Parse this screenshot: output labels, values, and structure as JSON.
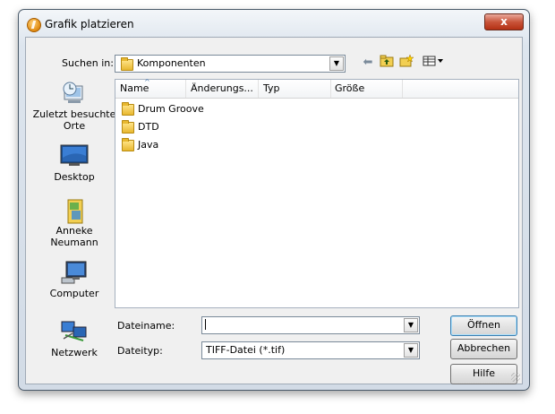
{
  "window": {
    "title": "Grafik platzieren",
    "close_symbol": "x"
  },
  "lookin": {
    "label": "Suchen in:",
    "value": "Komponenten"
  },
  "toolbar": {
    "back_icon": "back-arrow-icon",
    "up_icon": "up-folder-icon",
    "new_icon": "new-folder-icon",
    "view_icon": "view-menu-icon"
  },
  "places": [
    {
      "label": "Zuletzt besuchte Orte",
      "icon": "recent-places-icon"
    },
    {
      "label": "Desktop",
      "icon": "desktop-icon"
    },
    {
      "label": "Anneke Neumann",
      "icon": "user-folder-icon"
    },
    {
      "label": "Computer",
      "icon": "computer-icon"
    },
    {
      "label": "Netzwerk",
      "icon": "network-icon"
    }
  ],
  "columns": [
    "Name",
    "Änderungs...",
    "Typ",
    "Größe"
  ],
  "files": [
    {
      "name": "Drum Groove"
    },
    {
      "name": "DTD"
    },
    {
      "name": "Java"
    }
  ],
  "filename": {
    "label": "Dateiname:",
    "value": ""
  },
  "filetype": {
    "label": "Dateityp:",
    "value": "TIFF-Datei (*.tif)"
  },
  "buttons": {
    "open": "Öffnen",
    "cancel": "Abbrechen",
    "help": "Hilfe"
  },
  "colors": {
    "title_bar": "#dde5ee",
    "close_button": "#c9553b",
    "client": "#f0f0f0",
    "default_button_border": "#3c7fb1"
  }
}
